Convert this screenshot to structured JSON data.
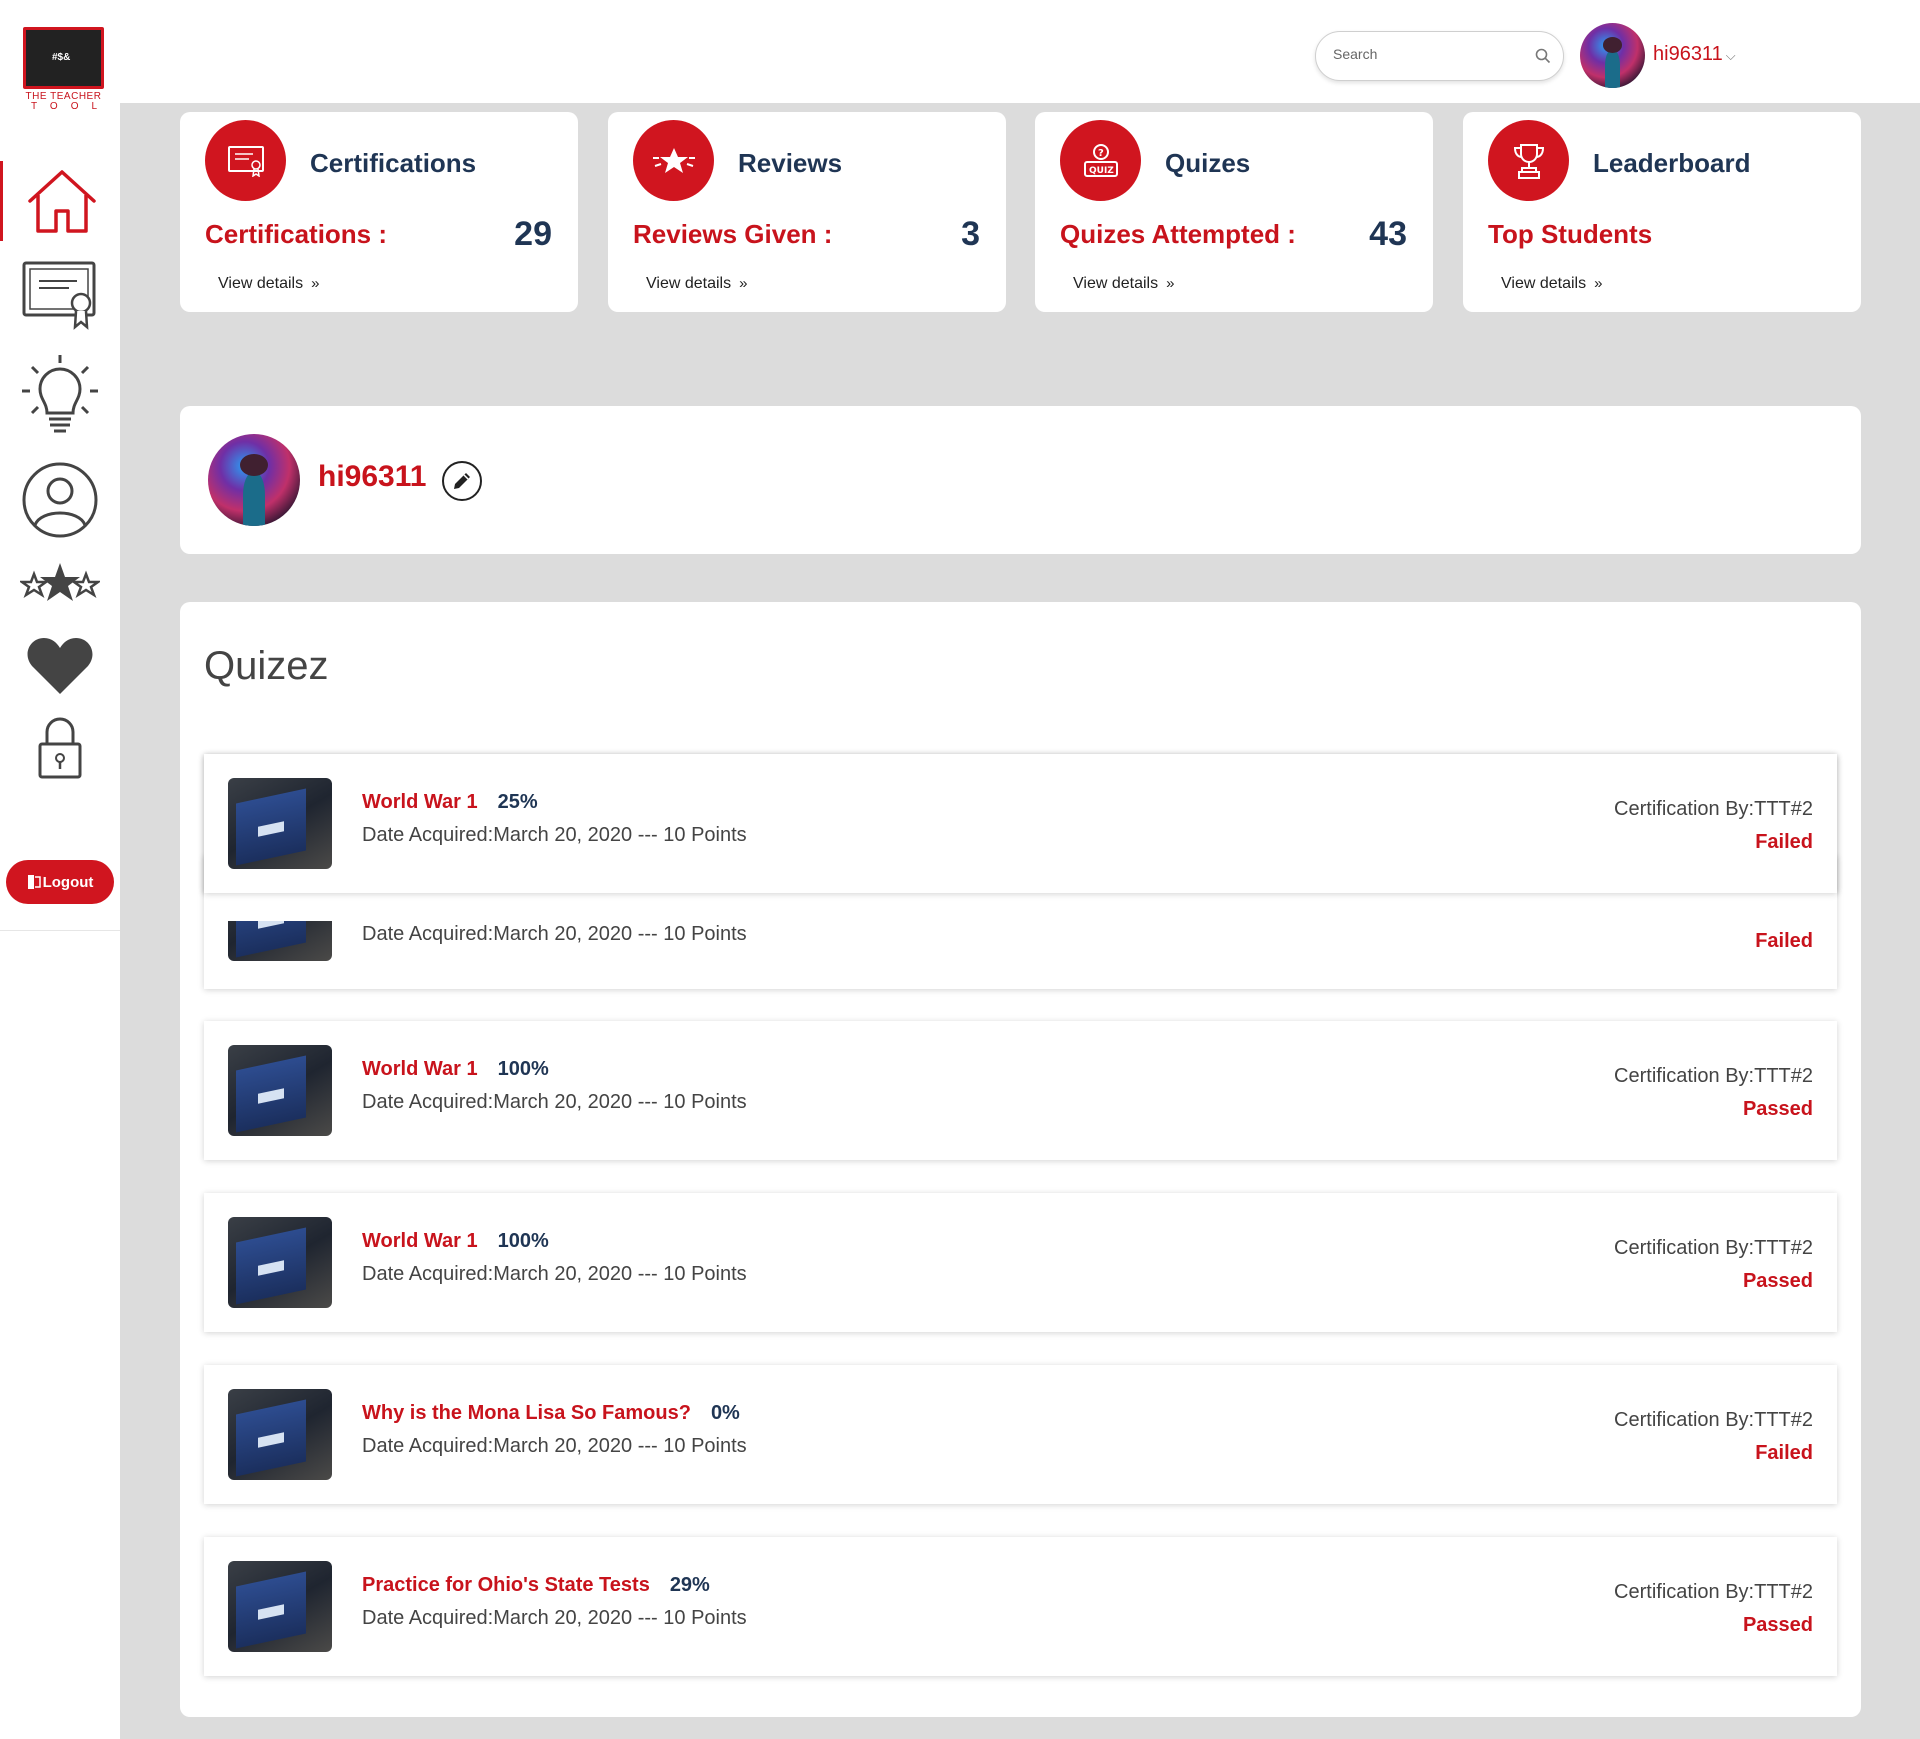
{
  "brand": {
    "name_line1": "THE TEACHER",
    "name_line2": "TOOL",
    "board_text": "#$&"
  },
  "header": {
    "search_placeholder": "Search",
    "username": "hi96311",
    "dropdown_glyph": "⌵"
  },
  "sidebar": {
    "items": [
      {
        "icon": "home-icon",
        "active": true
      },
      {
        "icon": "certificate-icon",
        "active": false
      },
      {
        "icon": "lightbulb-icon",
        "active": false
      },
      {
        "icon": "user-profile-icon",
        "active": false
      },
      {
        "icon": "stars-icon",
        "active": false
      },
      {
        "icon": "heart-icon",
        "active": false
      },
      {
        "icon": "lock-icon",
        "active": false
      }
    ],
    "logout_label": "Logout"
  },
  "stat_cards": [
    {
      "title": "Certifications",
      "label": "Certifications :",
      "value": "29",
      "link": "View details",
      "icon": "certificate-icon"
    },
    {
      "title": "Reviews",
      "label": "Reviews Given :",
      "value": "3",
      "link": "View details",
      "icon": "star-badge-icon"
    },
    {
      "title": "Quizes",
      "label": "Quizes Attempted :",
      "value": "43",
      "link": "View details",
      "icon": "quiz-icon"
    },
    {
      "title": "Leaderboard",
      "label": "Top Students",
      "value": "",
      "link": "View details",
      "icon": "trophy-icon"
    }
  ],
  "profile": {
    "username": "hi96311"
  },
  "quizzes": {
    "heading": "Quizez",
    "rows": [
      {
        "title": "World War 1",
        "percent": "25%",
        "meta": "Date Acquired:March 20, 2020 --- 10 Points",
        "cert": "Certification By:TTT#2",
        "status": "Failed"
      },
      {
        "title": "",
        "percent": "",
        "meta": "Date Acquired:March 20, 2020 --- 10 Points",
        "cert": "",
        "status": "Failed"
      },
      {
        "title": "World War 1",
        "percent": "100%",
        "meta": "Date Acquired:March 20, 2020 --- 10 Points",
        "cert": "Certification By:TTT#2",
        "status": "Passed"
      },
      {
        "title": "World War 1",
        "percent": "100%",
        "meta": "Date Acquired:March 20, 2020 --- 10 Points",
        "cert": "Certification By:TTT#2",
        "status": "Passed"
      },
      {
        "title": "Why is the Mona Lisa So Famous?",
        "percent": "0%",
        "meta": "Date Acquired:March 20, 2020 --- 10 Points",
        "cert": "Certification By:TTT#2",
        "status": "Failed"
      },
      {
        "title": "Practice for Ohio's State Tests",
        "percent": "29%",
        "meta": "Date Acquired:March 20, 2020 --- 10 Points",
        "cert": "Certification By:TTT#2",
        "status": "Passed"
      }
    ]
  },
  "colors": {
    "accent": "#d0151f",
    "navy": "#1f3554",
    "background": "#dcdcdc"
  }
}
